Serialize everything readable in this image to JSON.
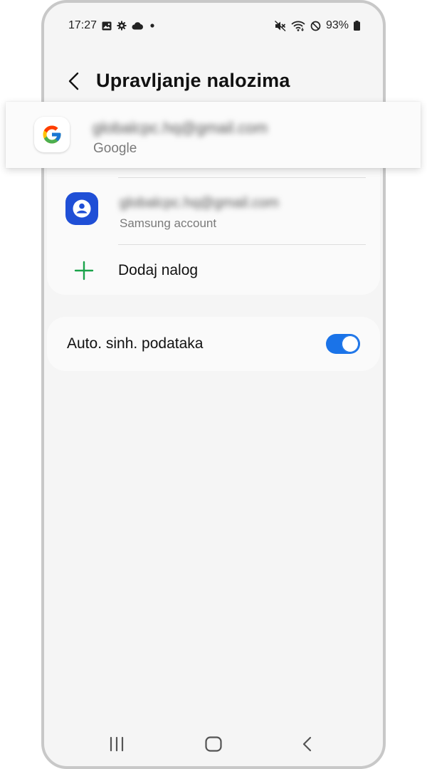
{
  "status_bar": {
    "time": "17:27",
    "battery": "93%"
  },
  "header": {
    "title": "Upravljanje nalozima"
  },
  "accounts": [
    {
      "email": "globalcpc.hq@gmail.com",
      "type": "Google",
      "icon": "google-icon"
    },
    {
      "email": "globalcpc.hq@gmail.com",
      "type": "Samsung account",
      "icon": "samsung-account-icon"
    }
  ],
  "add_account": {
    "label": "Dodaj nalog"
  },
  "sync": {
    "label": "Auto. sinh. podataka",
    "enabled": true
  },
  "colors": {
    "accent": "#1a73e8",
    "plus": "#1aa34a",
    "samsung": "#1f4fd6"
  }
}
